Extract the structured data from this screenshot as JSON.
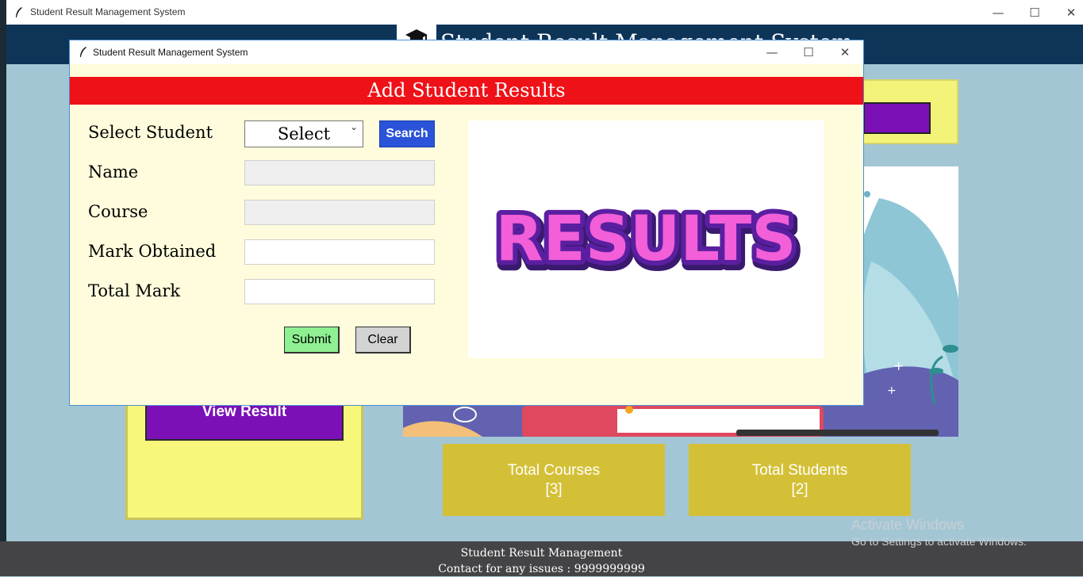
{
  "main_window": {
    "title": "Student Result Management System",
    "header_title": "Student Result Management System",
    "view_result_label": "View Result",
    "stats": [
      {
        "label": "Total Courses",
        "value": "[3]"
      },
      {
        "label": "Total Students",
        "value": "[2]"
      }
    ],
    "footer": {
      "line1": "Student  Result Management",
      "line2": "Contact for any issues : 9999999999"
    }
  },
  "dialog": {
    "title": "Student Result Management System",
    "heading": "Add Student Results",
    "fields": {
      "select_student_label": "Select Student",
      "select_value": "Select",
      "name_label": "Name",
      "course_label": "Course",
      "mark_obtained_label": "Mark Obtained",
      "total_mark_label": "Total Mark"
    },
    "buttons": {
      "search": "Search",
      "submit": "Submit",
      "clear": "Clear"
    },
    "image_text": "RESULTS"
  },
  "watermark": {
    "line1": "Activate Windows",
    "line2": "Go to Settings to activate Windows."
  },
  "colors": {
    "header_bg": "#0e3458",
    "dialog_heading_bg": "#ef1118",
    "search_button": "#2a53d9",
    "submit_button": "#8ff092",
    "purple_button": "#7a10b6",
    "stat_card": "#d4c037",
    "panel_yellow": "#f6f77b",
    "background": "#a3c6d4"
  },
  "icons": [
    "feather-icon",
    "graduation-cap-icon",
    "minimize-icon",
    "maximize-icon",
    "close-icon",
    "chevron-down-icon"
  ]
}
